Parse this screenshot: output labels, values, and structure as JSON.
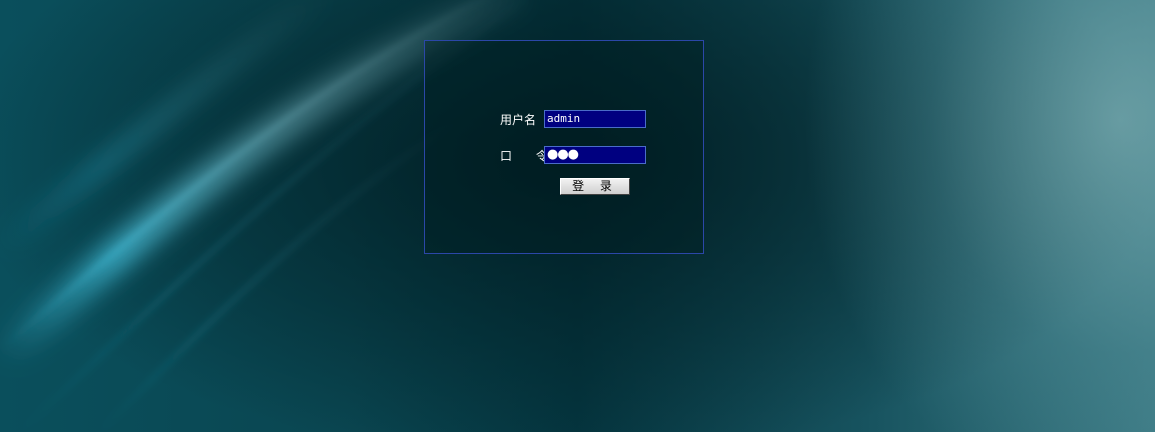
{
  "login": {
    "username_label": "用户名",
    "username_value": "admin",
    "password_label": "口 令",
    "password_value": "●●●",
    "submit_label": "登 录"
  },
  "colors": {
    "field_bg": "#000080",
    "panel_border": "#2b47a8"
  }
}
